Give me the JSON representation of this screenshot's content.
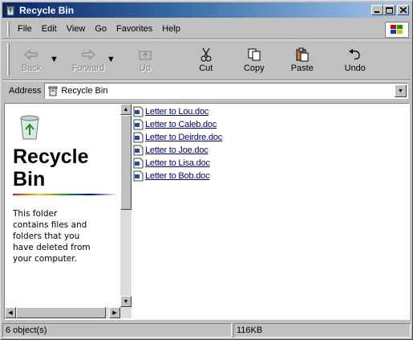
{
  "window": {
    "title": "Recycle Bin"
  },
  "menu": {
    "items": [
      "File",
      "Edit",
      "View",
      "Go",
      "Favorites",
      "Help"
    ]
  },
  "toolbar": {
    "back": "Back",
    "forward": "Forward",
    "up": "Up",
    "cut": "Cut",
    "copy": "Copy",
    "paste": "Paste",
    "undo": "Undo"
  },
  "address": {
    "label": "Address",
    "value": "Recycle Bin"
  },
  "left_pane": {
    "title_line1": "Recycle",
    "title_line2": "Bin",
    "description": "This folder contains files and folders that you have deleted from your computer."
  },
  "files": [
    "Letter to Lou.doc",
    "Letter to Caleb.doc",
    "Letter to Deirdre.doc",
    "Letter to Joe.doc",
    "Letter to Lisa.doc",
    "Letter to Bob.doc"
  ],
  "status": {
    "objects": "6 object(s)",
    "size": "116KB"
  },
  "colors": {
    "titlebar": "#0a246a",
    "chrome": "#c0c0c0",
    "link": "#000080"
  }
}
